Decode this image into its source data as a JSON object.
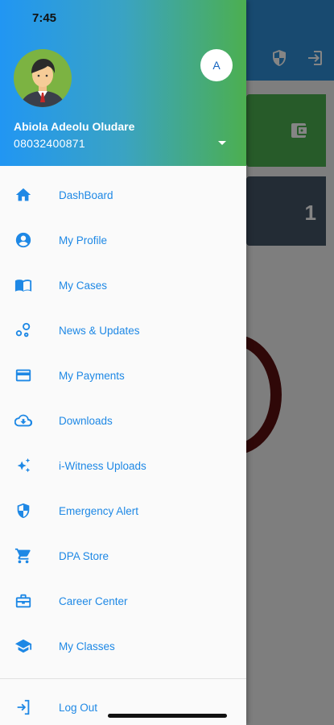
{
  "status_bar": {
    "time": "7:45"
  },
  "account": {
    "avatar_initial": "A",
    "name": "Abiola Adeolu Oludare",
    "phone": "08032400871"
  },
  "menu": {
    "items": [
      {
        "label": "DashBoard",
        "icon": "home-icon"
      },
      {
        "label": "My Profile",
        "icon": "account-circle-icon"
      },
      {
        "label": "My Cases",
        "icon": "book-open-icon"
      },
      {
        "label": "News & Updates",
        "icon": "bubbles-icon"
      },
      {
        "label": "My Payments",
        "icon": "credit-card-icon"
      },
      {
        "label": "Downloads",
        "icon": "cloud-download-icon"
      },
      {
        "label": "i-Witness Uploads",
        "icon": "sparkle-icon"
      },
      {
        "label": "Emergency Alert",
        "icon": "shield-icon"
      },
      {
        "label": "DPA Store",
        "icon": "cart-icon"
      },
      {
        "label": "Career Center",
        "icon": "briefcase-icon"
      },
      {
        "label": "My Classes",
        "icon": "graduation-cap-icon"
      }
    ],
    "logout_label": "Log Out"
  },
  "background": {
    "count": "1"
  },
  "colors": {
    "accent_blue": "#1e88e5",
    "header_gradient_start": "#2196f3",
    "header_gradient_end": "#4caf50"
  }
}
